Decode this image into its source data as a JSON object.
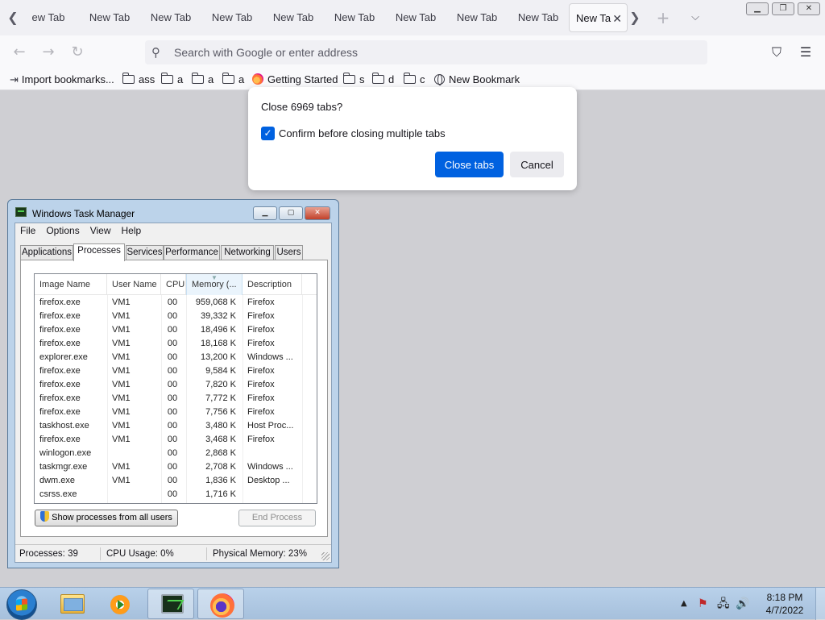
{
  "browser": {
    "tabs": [
      {
        "label": "ew Tab"
      },
      {
        "label": "New Tab"
      },
      {
        "label": "New Tab"
      },
      {
        "label": "New Tab"
      },
      {
        "label": "New Tab"
      },
      {
        "label": "New Tab"
      },
      {
        "label": "New Tab"
      },
      {
        "label": "New Tab"
      },
      {
        "label": "New Tab"
      },
      {
        "label": "New Ta"
      }
    ],
    "active_tab_index": 9,
    "search_placeholder": "Search with Google or enter address",
    "bookmarks": [
      {
        "label": "Import bookmarks...",
        "icon": "import-icon"
      },
      {
        "label": "ass",
        "icon": "folder-icon"
      },
      {
        "label": "a",
        "icon": "folder-icon"
      },
      {
        "label": "a",
        "icon": "folder-icon"
      },
      {
        "label": "a",
        "icon": "folder-icon"
      },
      {
        "label": "Getting Started",
        "icon": "firefox-icon"
      },
      {
        "label": "s",
        "icon": "folder-icon"
      },
      {
        "label": "d",
        "icon": "folder-icon"
      },
      {
        "label": "c",
        "icon": "folder-icon"
      },
      {
        "label": "New Bookmark",
        "icon": "globe-icon"
      }
    ]
  },
  "dialog": {
    "title": "Close 6969 tabs?",
    "checkbox_label": "Confirm before closing multiple tabs",
    "checkbox_checked": true,
    "primary_button": "Close tabs",
    "secondary_button": "Cancel",
    "accent_color": "#0061e0"
  },
  "task_manager": {
    "title": "Windows Task Manager",
    "menu": [
      "File",
      "Options",
      "View",
      "Help"
    ],
    "tabs": [
      "Applications",
      "Processes",
      "Services",
      "Performance",
      "Networking",
      "Users"
    ],
    "active_tab": "Processes",
    "columns": [
      "Image Name",
      "User Name",
      "CPU",
      "Memory (...",
      "Description"
    ],
    "processes": [
      {
        "name": "firefox.exe",
        "user": "VM1",
        "cpu": "00",
        "memory": "959,068 K",
        "desc": "Firefox"
      },
      {
        "name": "firefox.exe",
        "user": "VM1",
        "cpu": "00",
        "memory": "39,332 K",
        "desc": "Firefox"
      },
      {
        "name": "firefox.exe",
        "user": "VM1",
        "cpu": "00",
        "memory": "18,496 K",
        "desc": "Firefox"
      },
      {
        "name": "firefox.exe",
        "user": "VM1",
        "cpu": "00",
        "memory": "18,168 K",
        "desc": "Firefox"
      },
      {
        "name": "explorer.exe",
        "user": "VM1",
        "cpu": "00",
        "memory": "13,200 K",
        "desc": "Windows ..."
      },
      {
        "name": "firefox.exe",
        "user": "VM1",
        "cpu": "00",
        "memory": "9,584 K",
        "desc": "Firefox"
      },
      {
        "name": "firefox.exe",
        "user": "VM1",
        "cpu": "00",
        "memory": "7,820 K",
        "desc": "Firefox"
      },
      {
        "name": "firefox.exe",
        "user": "VM1",
        "cpu": "00",
        "memory": "7,772 K",
        "desc": "Firefox"
      },
      {
        "name": "firefox.exe",
        "user": "VM1",
        "cpu": "00",
        "memory": "7,756 K",
        "desc": "Firefox"
      },
      {
        "name": "taskhost.exe",
        "user": "VM1",
        "cpu": "00",
        "memory": "3,480 K",
        "desc": "Host Proc..."
      },
      {
        "name": "firefox.exe",
        "user": "VM1",
        "cpu": "00",
        "memory": "3,468 K",
        "desc": "Firefox"
      },
      {
        "name": "winlogon.exe",
        "user": "",
        "cpu": "00",
        "memory": "2,868 K",
        "desc": ""
      },
      {
        "name": "taskmgr.exe",
        "user": "VM1",
        "cpu": "00",
        "memory": "2,708 K",
        "desc": "Windows ..."
      },
      {
        "name": "dwm.exe",
        "user": "VM1",
        "cpu": "00",
        "memory": "1,836 K",
        "desc": "Desktop ..."
      },
      {
        "name": "csrss.exe",
        "user": "",
        "cpu": "00",
        "memory": "1,716 K",
        "desc": ""
      }
    ],
    "show_all_button": "Show processes from all users",
    "end_process_button": "End Process",
    "status": {
      "processes": "Processes: 39",
      "cpu": "CPU Usage: 0%",
      "memory": "Physical Memory: 23%"
    }
  },
  "taskbar": {
    "time": "8:18 PM",
    "date": "4/7/2022"
  }
}
